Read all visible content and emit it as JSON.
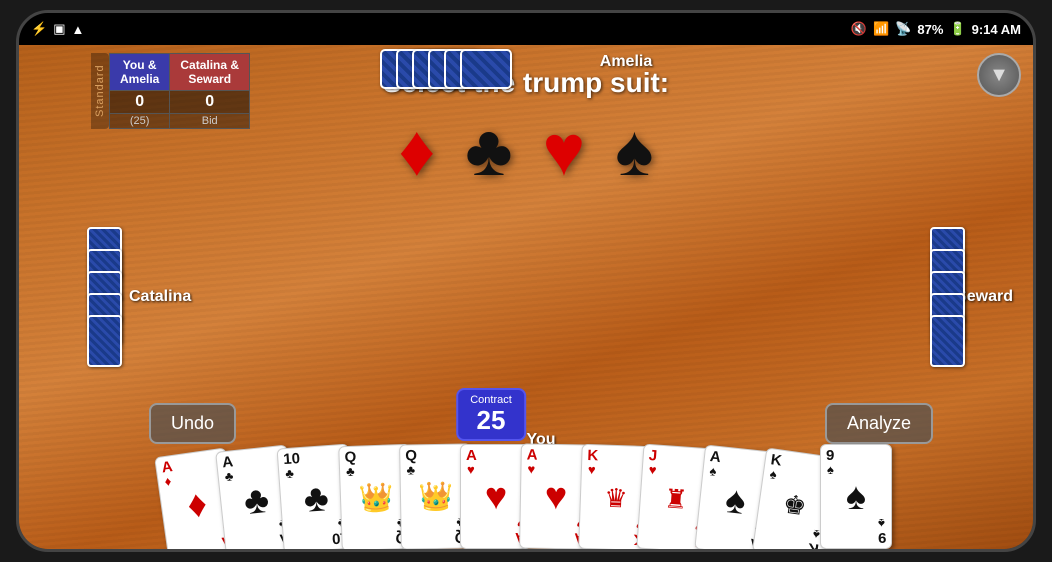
{
  "statusBar": {
    "time": "9:14 AM",
    "battery": "87%",
    "icons": [
      "usb",
      "sim",
      "wifi",
      "signal-mute",
      "wifi-active",
      "signal-bars"
    ]
  },
  "game": {
    "mode": "Standard",
    "trumpTitle": "Select the trump suit:",
    "suits": [
      {
        "name": "diamond",
        "symbol": "♦",
        "color": "red"
      },
      {
        "name": "club",
        "symbol": "♣",
        "color": "black"
      },
      {
        "name": "heart",
        "symbol": "♥",
        "color": "red"
      },
      {
        "name": "spade",
        "symbol": "♠",
        "color": "black"
      }
    ],
    "players": {
      "top": "Amelia",
      "right": "Seward",
      "left": "Catalina",
      "bottom": "You"
    },
    "contract": {
      "label": "Contract",
      "number": "25"
    },
    "scores": {
      "team1": {
        "name1": "You &",
        "name2": "Amelia",
        "score": "0"
      },
      "team2": {
        "name1": "Catalina &",
        "name2": "Seward",
        "score": "0"
      },
      "bid_label": "(25)",
      "bid_text": "Bid"
    },
    "buttons": {
      "undo": "Undo",
      "analyze": "Analyze"
    },
    "hand": [
      {
        "rank": "A",
        "suit": "♦",
        "color": "red",
        "type": "pip"
      },
      {
        "rank": "A",
        "suit": "♣",
        "color": "black",
        "type": "pip"
      },
      {
        "rank": "10",
        "suit": "♣",
        "color": "black",
        "type": "pip"
      },
      {
        "rank": "Q",
        "suit": "♣",
        "color": "black",
        "type": "face"
      },
      {
        "rank": "Q",
        "suit": "♣",
        "color": "black",
        "type": "face"
      },
      {
        "rank": "A",
        "suit": "♥",
        "color": "red",
        "type": "pip"
      },
      {
        "rank": "A",
        "suit": "♥",
        "color": "red",
        "type": "pip"
      },
      {
        "rank": "K",
        "suit": "♥",
        "color": "red",
        "type": "face"
      },
      {
        "rank": "J",
        "suit": "♥",
        "color": "red",
        "type": "face"
      },
      {
        "rank": "A",
        "suit": "♠",
        "color": "black",
        "type": "pip"
      },
      {
        "rank": "K",
        "suit": "♠",
        "color": "black",
        "type": "face"
      },
      {
        "rank": "9",
        "suit": "♠",
        "color": "black",
        "type": "pip"
      }
    ]
  }
}
